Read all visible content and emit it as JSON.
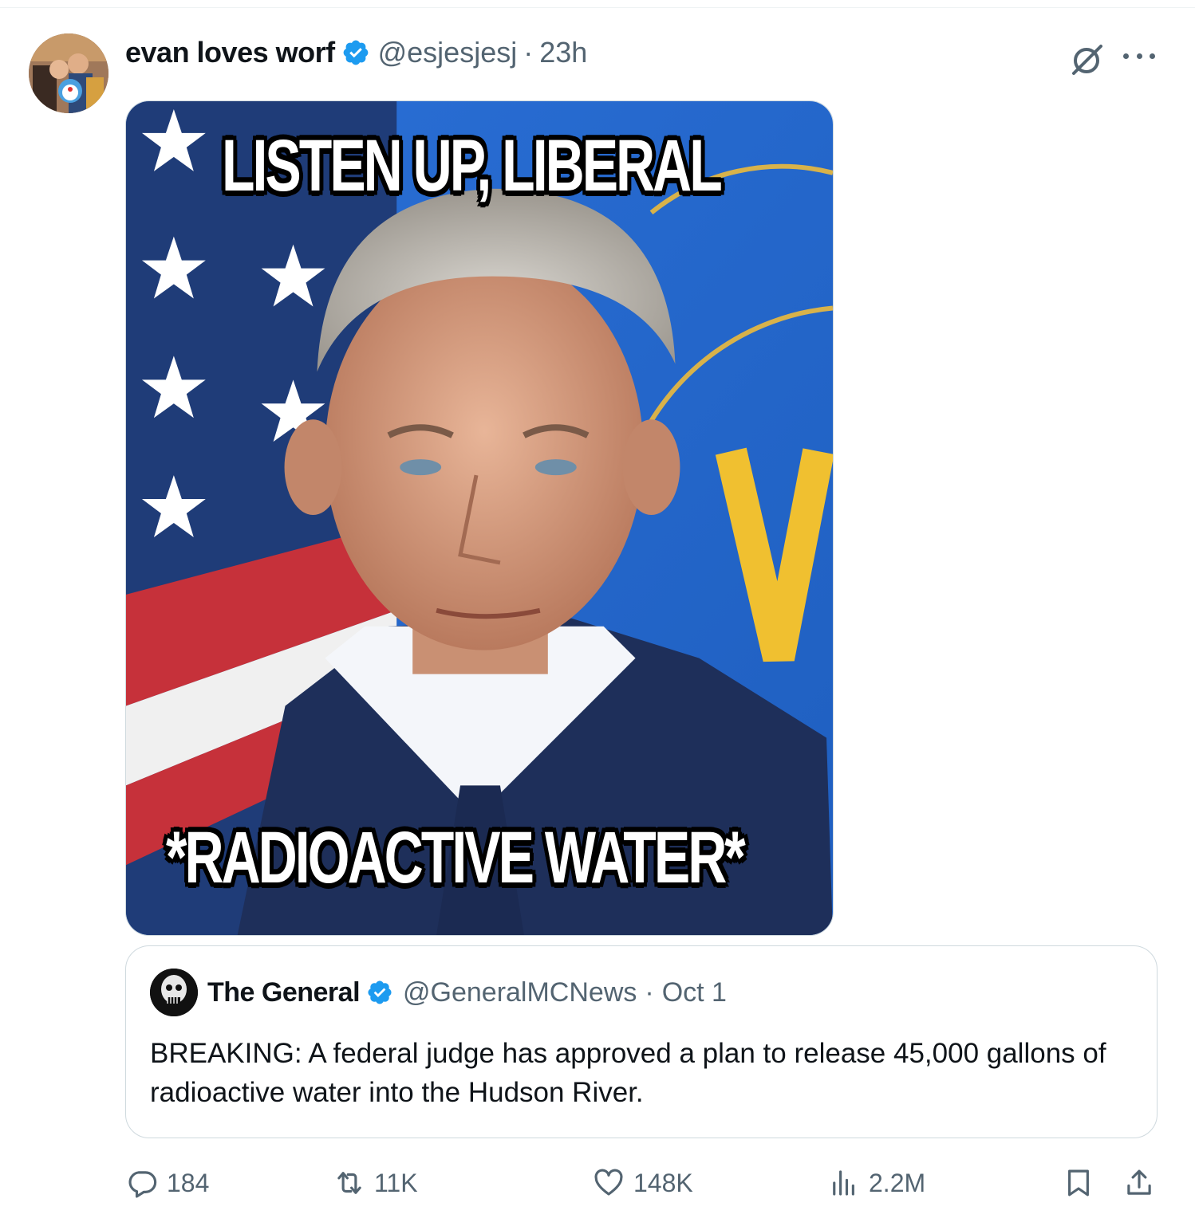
{
  "tweet": {
    "display_name": "evan loves worf",
    "handle": "@esjesjesj",
    "separator": "·",
    "time": "23h",
    "image_text_top": "LISTEN UP, LIBERAL",
    "image_text_bottom": "*RADIOACTIVE WATER*"
  },
  "quote": {
    "display_name": "The General",
    "handle": "@GeneralMCNews",
    "separator": "·",
    "date": "Oct 1",
    "text": "BREAKING: A federal judge has approved a plan to release 45,000 gallons of radioactive water into the Hudson River."
  },
  "actions": {
    "replies": "184",
    "reposts": "11K",
    "likes": "148K",
    "views": "2.2M"
  },
  "icons": {
    "header_right": [
      "grok-icon",
      "more-icon"
    ],
    "action_bar": [
      "reply-icon",
      "repost-icon",
      "like-icon",
      "views-icon",
      "bookmark-icon",
      "share-icon"
    ]
  },
  "colors": {
    "verified_blue": "#1d9bf0",
    "secondary_text": "#536471",
    "primary_text": "#0f1419",
    "border": "#cfd9de"
  }
}
